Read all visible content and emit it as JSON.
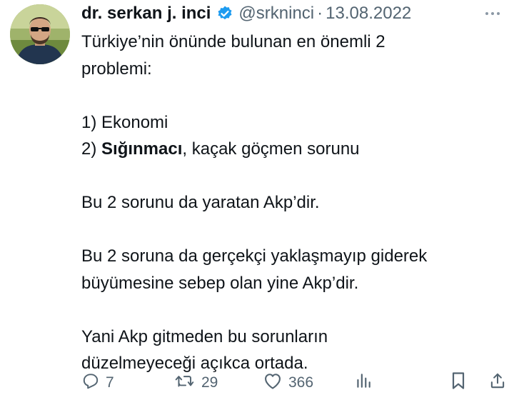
{
  "author": {
    "display_name": "dr. serkan j. inci",
    "handle": "@srkninci",
    "separator": "·",
    "date": "13.08.2022"
  },
  "tweet": {
    "line_1": "Türkiye’nin önünde bulunan en önemli 2",
    "line_2": "problemi:",
    "item_1": "1) Ekonomi",
    "item_2_prefix": "2) ",
    "item_2_bold": "Sığınmacı",
    "item_2_rest": ", kaçak göçmen sorunu",
    "para_2": "Bu 2 sorunu da yaratan Akp’dir.",
    "para_3_line_1": "Bu 2 soruna da gerçekçi yaklaşmayıp giderek",
    "para_3_line_2": "büyümesine sebep olan yine Akp’dir.",
    "para_4_line_1": "Yani Akp gitmeden bu sorunların",
    "para_4_line_2": "düzelmeyeceği açıkca ortada."
  },
  "actions": {
    "replies": "7",
    "retweets": "29",
    "likes": "366"
  },
  "icons": {
    "verified": "verified-badge-icon",
    "more": "more-options-icon",
    "reply": "reply-icon",
    "retweet": "retweet-icon",
    "like": "heart-icon",
    "views": "views-chart-icon",
    "bookmark": "bookmark-icon",
    "share": "share-icon"
  },
  "colors": {
    "text": "#0f1419",
    "secondary": "#536471",
    "verified": "#1d9bf0"
  }
}
